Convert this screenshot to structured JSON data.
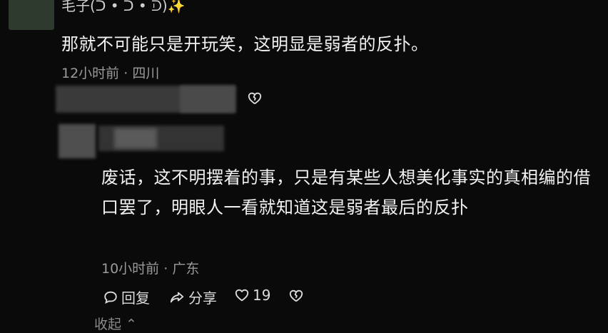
{
  "comment": {
    "username": "毛子(ᑒ • ᑐ • ᑓ)✨",
    "text": "那就不可能只是开玩笑，这明显是弱者的反扑。",
    "time": "12小时前",
    "separator": " · ",
    "location": "四川"
  },
  "reply": {
    "text": "废话，这不明摆着的事，只是有某些人想美化事实的真相编的借口罢了，明眼人一看就知道这是弱者最后的反扑",
    "time": "10小时前",
    "separator": " · ",
    "location": "广东",
    "actions": {
      "reply_label": "回复",
      "share_label": "分享",
      "like_count": "19"
    },
    "collapse_label": "收起"
  },
  "icons": {
    "dislike": "broken-heart-icon",
    "reply": "speech-bubble-icon",
    "share": "share-arrow-icon",
    "like": "heart-icon",
    "collapse": "chevron-up-icon"
  }
}
